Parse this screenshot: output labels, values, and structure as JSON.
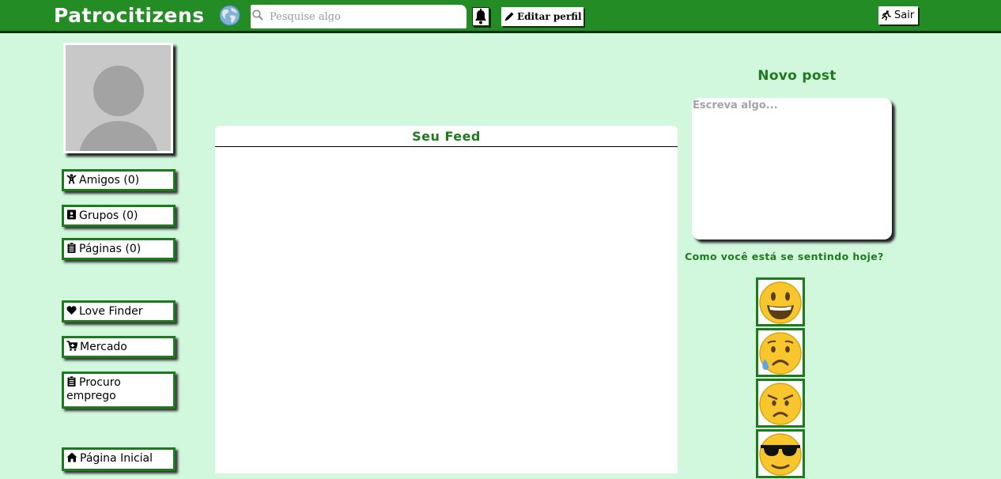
{
  "header": {
    "brand": "Patrocitizens",
    "search_placeholder": "Pesquise algo",
    "edit_profile_label": "Editar perfil",
    "logout_label": "Sair",
    "icons": {
      "brand": "globe-icon",
      "search": "search-icon",
      "notifications": "bell-icon",
      "edit": "pencil-icon",
      "logout": "running-exit-icon"
    },
    "colors": {
      "bar": "#248c24",
      "background": "#d1f8dc",
      "accent": "#1f7a1f"
    }
  },
  "sidebar": {
    "avatar_icon": "default-user-avatar",
    "items": [
      {
        "label": "Amigos (0)",
        "icon": "person-icon"
      },
      {
        "label": "Grupos (0)",
        "icon": "contact-book-icon"
      },
      {
        "label": "Páginas (0)",
        "icon": "clipboard-icon"
      },
      {
        "label": "Love Finder",
        "icon": "heart-icon"
      },
      {
        "label": "Mercado",
        "icon": "cart-icon"
      },
      {
        "label": "Procuro emprego",
        "icon": "clipboard-icon"
      },
      {
        "label": "Página Inicial",
        "icon": "home-icon"
      }
    ]
  },
  "feed": {
    "title": "Seu Feed"
  },
  "post": {
    "title": "Novo post",
    "placeholder": "Escreva algo...",
    "feeling_question": "Como você está se sentindo hoje?",
    "moods": [
      "smiling-face-icon",
      "sad-sweat-face-icon",
      "angry-face-icon",
      "sunglasses-face-icon"
    ]
  }
}
